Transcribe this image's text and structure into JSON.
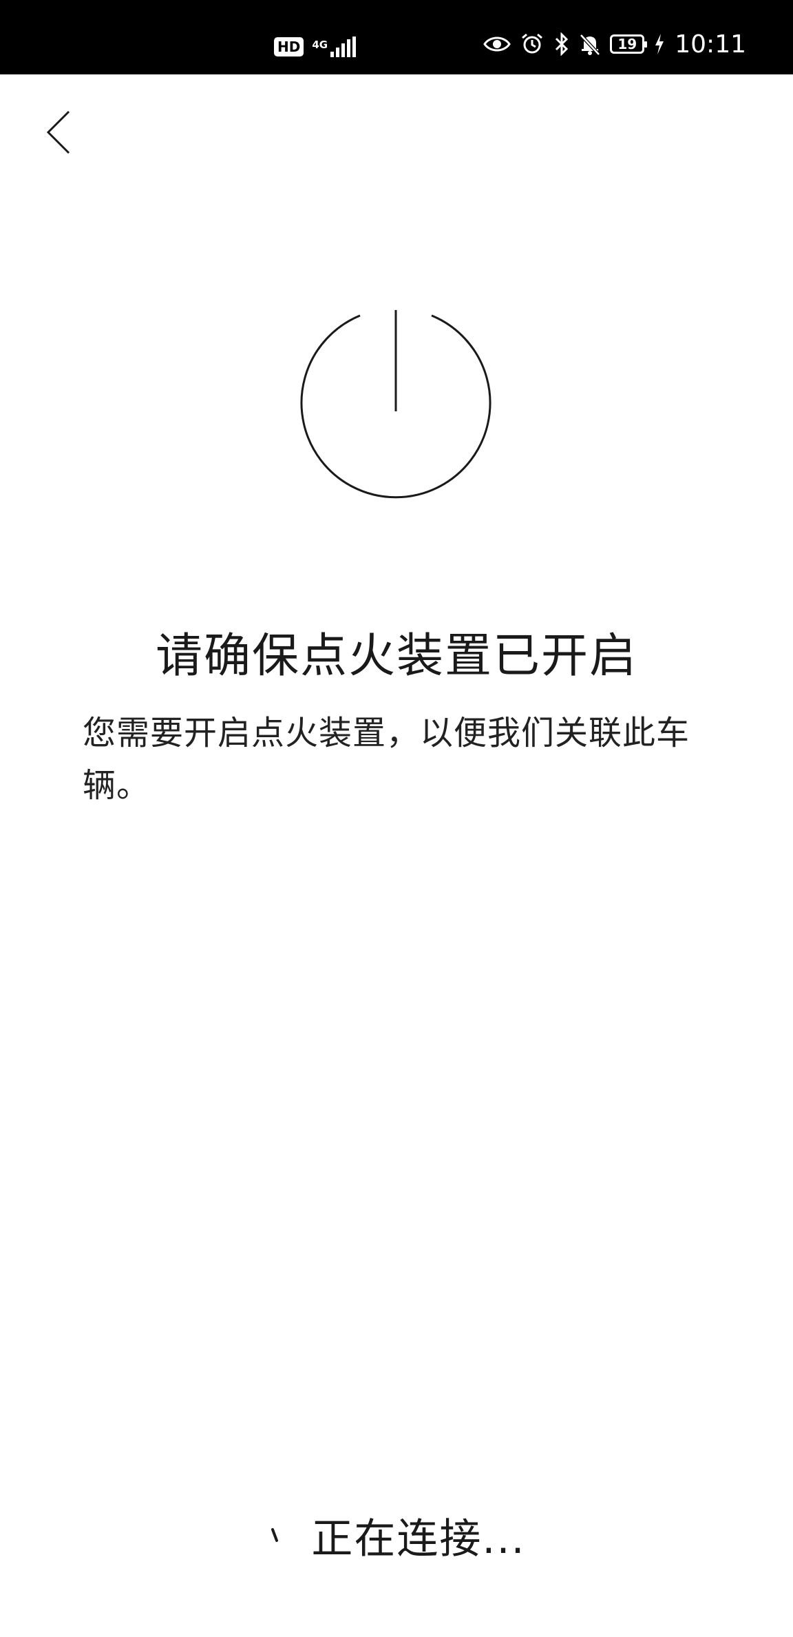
{
  "status_bar": {
    "hd_badge": "HD",
    "network_type": "4G",
    "battery_level": "19",
    "time": "10:11",
    "icons": [
      "hd-icon",
      "signal-icon",
      "eye-icon",
      "alarm-icon",
      "bluetooth-icon",
      "mute-bell-icon",
      "battery-icon",
      "charging-icon"
    ]
  },
  "nav": {
    "back_icon": "chevron-left-icon"
  },
  "main": {
    "icon": "power-icon",
    "title": "请确保点火装置已开启",
    "description": "您需要开启点火装置，以便我们关联此车辆。"
  },
  "footer": {
    "status_text": "正在连接...",
    "spinner_icon": "loading-spinner-icon"
  },
  "colors": {
    "status_bar_bg": "#000000",
    "background": "#ffffff",
    "text": "#1a1a1a"
  }
}
